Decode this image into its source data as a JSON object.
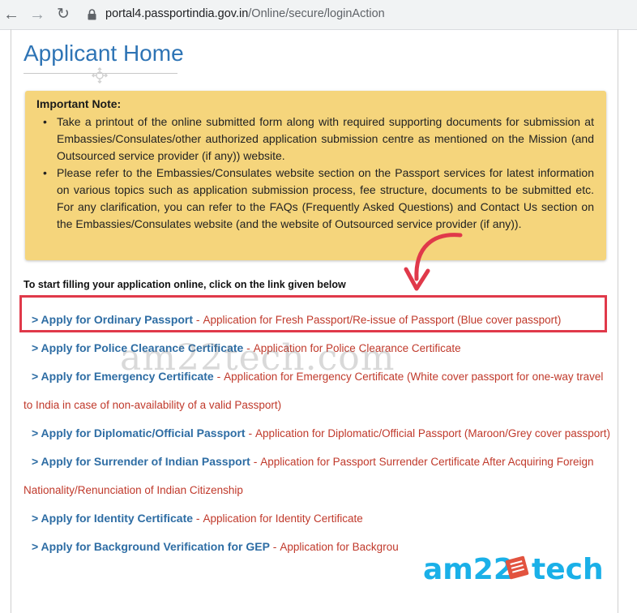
{
  "browser": {
    "url_host": "portal4.passportindia.gov.in",
    "url_path": "/Online/secure/loginAction",
    "icons": [
      "back-arrow-icon",
      "forward-arrow-icon",
      "reload-icon",
      "lock-icon"
    ]
  },
  "page": {
    "title": "Applicant Home"
  },
  "note": {
    "heading": "Important Note:",
    "items": [
      "Take a printout of the online submitted form along with required supporting documents for submission at Embassies/Consulates/other authorized application submission centre as mentioned on the Mission (and Outsourced service provider (if any)) website.",
      "Please refer to the Embassies/Consulates website section on the Passport services for latest information on various topics such as application submission process, fee structure, documents to be submitted etc. For any clarification, you can refer to the FAQs (Frequently Asked Questions) and Contact Us section on the Embassies/Consulates website (and the website of Outsourced service provider (if any))."
    ],
    "background_color": "#f5d57c"
  },
  "instruction": "To start filling your application online, click on the link given below",
  "links": [
    {
      "title": "> Apply for Ordinary Passport",
      "sep": " - ",
      "desc": "Application for Fresh Passport/Re-issue of Passport (Blue cover passport)"
    },
    {
      "title": "> Apply for Police Clearance Certificate",
      "sep": " - ",
      "desc": "Application for Police Clearance Certificate"
    },
    {
      "title": "> Apply for Emergency Certificate",
      "sep": " - ",
      "desc": "Application for Emergency Certificate (White cover passport for one-way travel to India in case of non-availability of a valid Passport)"
    },
    {
      "title": "> Apply for Diplomatic/Official Passport",
      "sep": " - ",
      "desc": "Application for Diplomatic/Official Passport (Maroon/Grey cover passport)"
    },
    {
      "title": "> Apply for Surrender of Indian Passport",
      "sep": " - ",
      "desc": "Application for Passport Surrender Certificate After Acquiring Foreign Nationality/Renunciation of Indian Citizenship"
    },
    {
      "title": "> Apply for Identity Certificate",
      "sep": " - ",
      "desc": "Application for Identity Certificate"
    },
    {
      "title": "> Apply for Background Verification for GEP",
      "sep": " - ",
      "desc": "Application for Backgrou"
    }
  ],
  "watermark": {
    "mid_text": "am22tech.com",
    "logo_left": "am22",
    "logo_right": "tech"
  },
  "colors": {
    "title": "#2e74b5",
    "link_title": "#2e6da4",
    "link_desc": "#c0392b",
    "highlight_border": "#e0394a",
    "arrow": "#e0394a",
    "watermark_logo": "#1ab0e8"
  }
}
